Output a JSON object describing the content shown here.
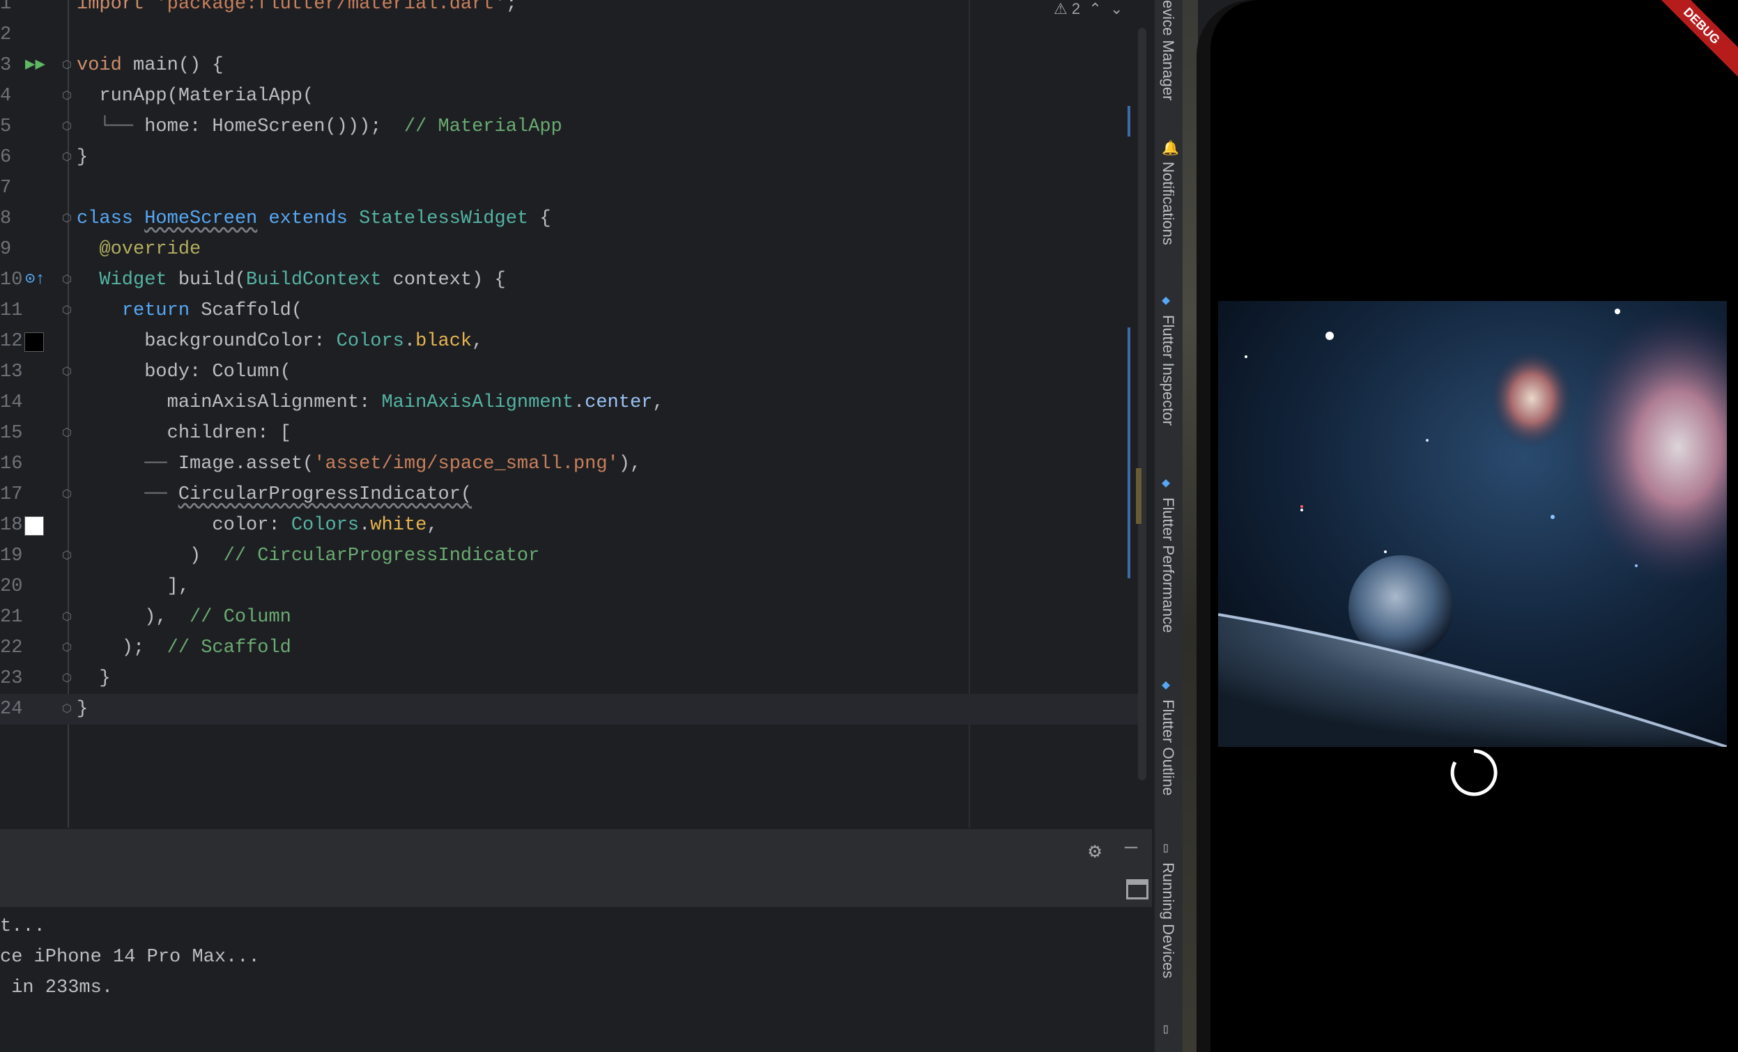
{
  "editor": {
    "inspection_count": "2",
    "lines": [
      {
        "n": "1",
        "html": "<span class='kw'>import</span> <span class='str2'>'package:flutter/material.dart'</span>;"
      },
      {
        "n": "2",
        "html": ""
      },
      {
        "n": "3",
        "html": "<span class='kw'>void</span> <span class='fn'>main</span>() {"
      },
      {
        "n": "4",
        "html": "  runApp(MaterialApp("
      },
      {
        "n": "5",
        "html": "<span class='tree'>  └──</span> home: HomeScreen()));  <span class='str'>// MaterialApp</span>"
      },
      {
        "n": "6",
        "html": "}"
      },
      {
        "n": "7",
        "html": ""
      },
      {
        "n": "8",
        "html": "<span class='kw2'>class</span> <span class='cls sq' style='color:#56a8f5'>HomeScreen</span> <span class='kw2'>extends</span> <span class='cls'>StatelessWidget</span> {"
      },
      {
        "n": "9",
        "html": "  <span class='ann'>@override</span>"
      },
      {
        "n": "10",
        "html": "  <span class='cls'>Widget</span> build(<span class='cls'>BuildContext</span> context) {"
      },
      {
        "n": "11",
        "html": "    <span class='kw2'>return</span> Scaffold("
      },
      {
        "n": "12",
        "html": "      backgroundColor: <span class='cls'>Colors</span>.<span style='color:#e6b450'>black</span>,"
      },
      {
        "n": "13",
        "html": "      body: Column("
      },
      {
        "n": "14",
        "html": "        mainAxisAlignment: <span class='cls'>MainAxisAlignment</span>.<span style='color:#9bc3f5'>center</span>,"
      },
      {
        "n": "15",
        "html": "        children: ["
      },
      {
        "n": "16",
        "html": "<span class='tree'>      ──</span> Image.asset(<span class='str2'>'asset/img/space_small.png'</span>),"
      },
      {
        "n": "17",
        "html": "<span class='tree'>      ──</span> <span class='sq'>CircularProgressIndicator(</span>"
      },
      {
        "n": "18",
        "html": "            color: <span class='cls'>Colors</span>.<span style='color:#e6b450'>white</span>,"
      },
      {
        "n": "19",
        "html": "          )  <span class='str'>// CircularProgressIndicator</span>"
      },
      {
        "n": "20",
        "html": "        ],"
      },
      {
        "n": "21",
        "html": "      ),  <span class='str'>// Column</span>"
      },
      {
        "n": "22",
        "html": "    );  <span class='str'>// Scaffold</span>"
      },
      {
        "n": "23",
        "html": "  }"
      },
      {
        "n": "24",
        "html": "}"
      }
    ]
  },
  "console": {
    "lines": [
      "t...",
      "ce iPhone 14 Pro Max...",
      " in 233ms."
    ]
  },
  "right_strip": {
    "tabs": [
      "evice Manager",
      "Notifications",
      "Flutter Inspector",
      "Flutter Performance",
      "Flutter Outline",
      "Running Devices"
    ]
  },
  "phone": {
    "debug_banner": "DEBUG",
    "image_name": "space-image"
  }
}
